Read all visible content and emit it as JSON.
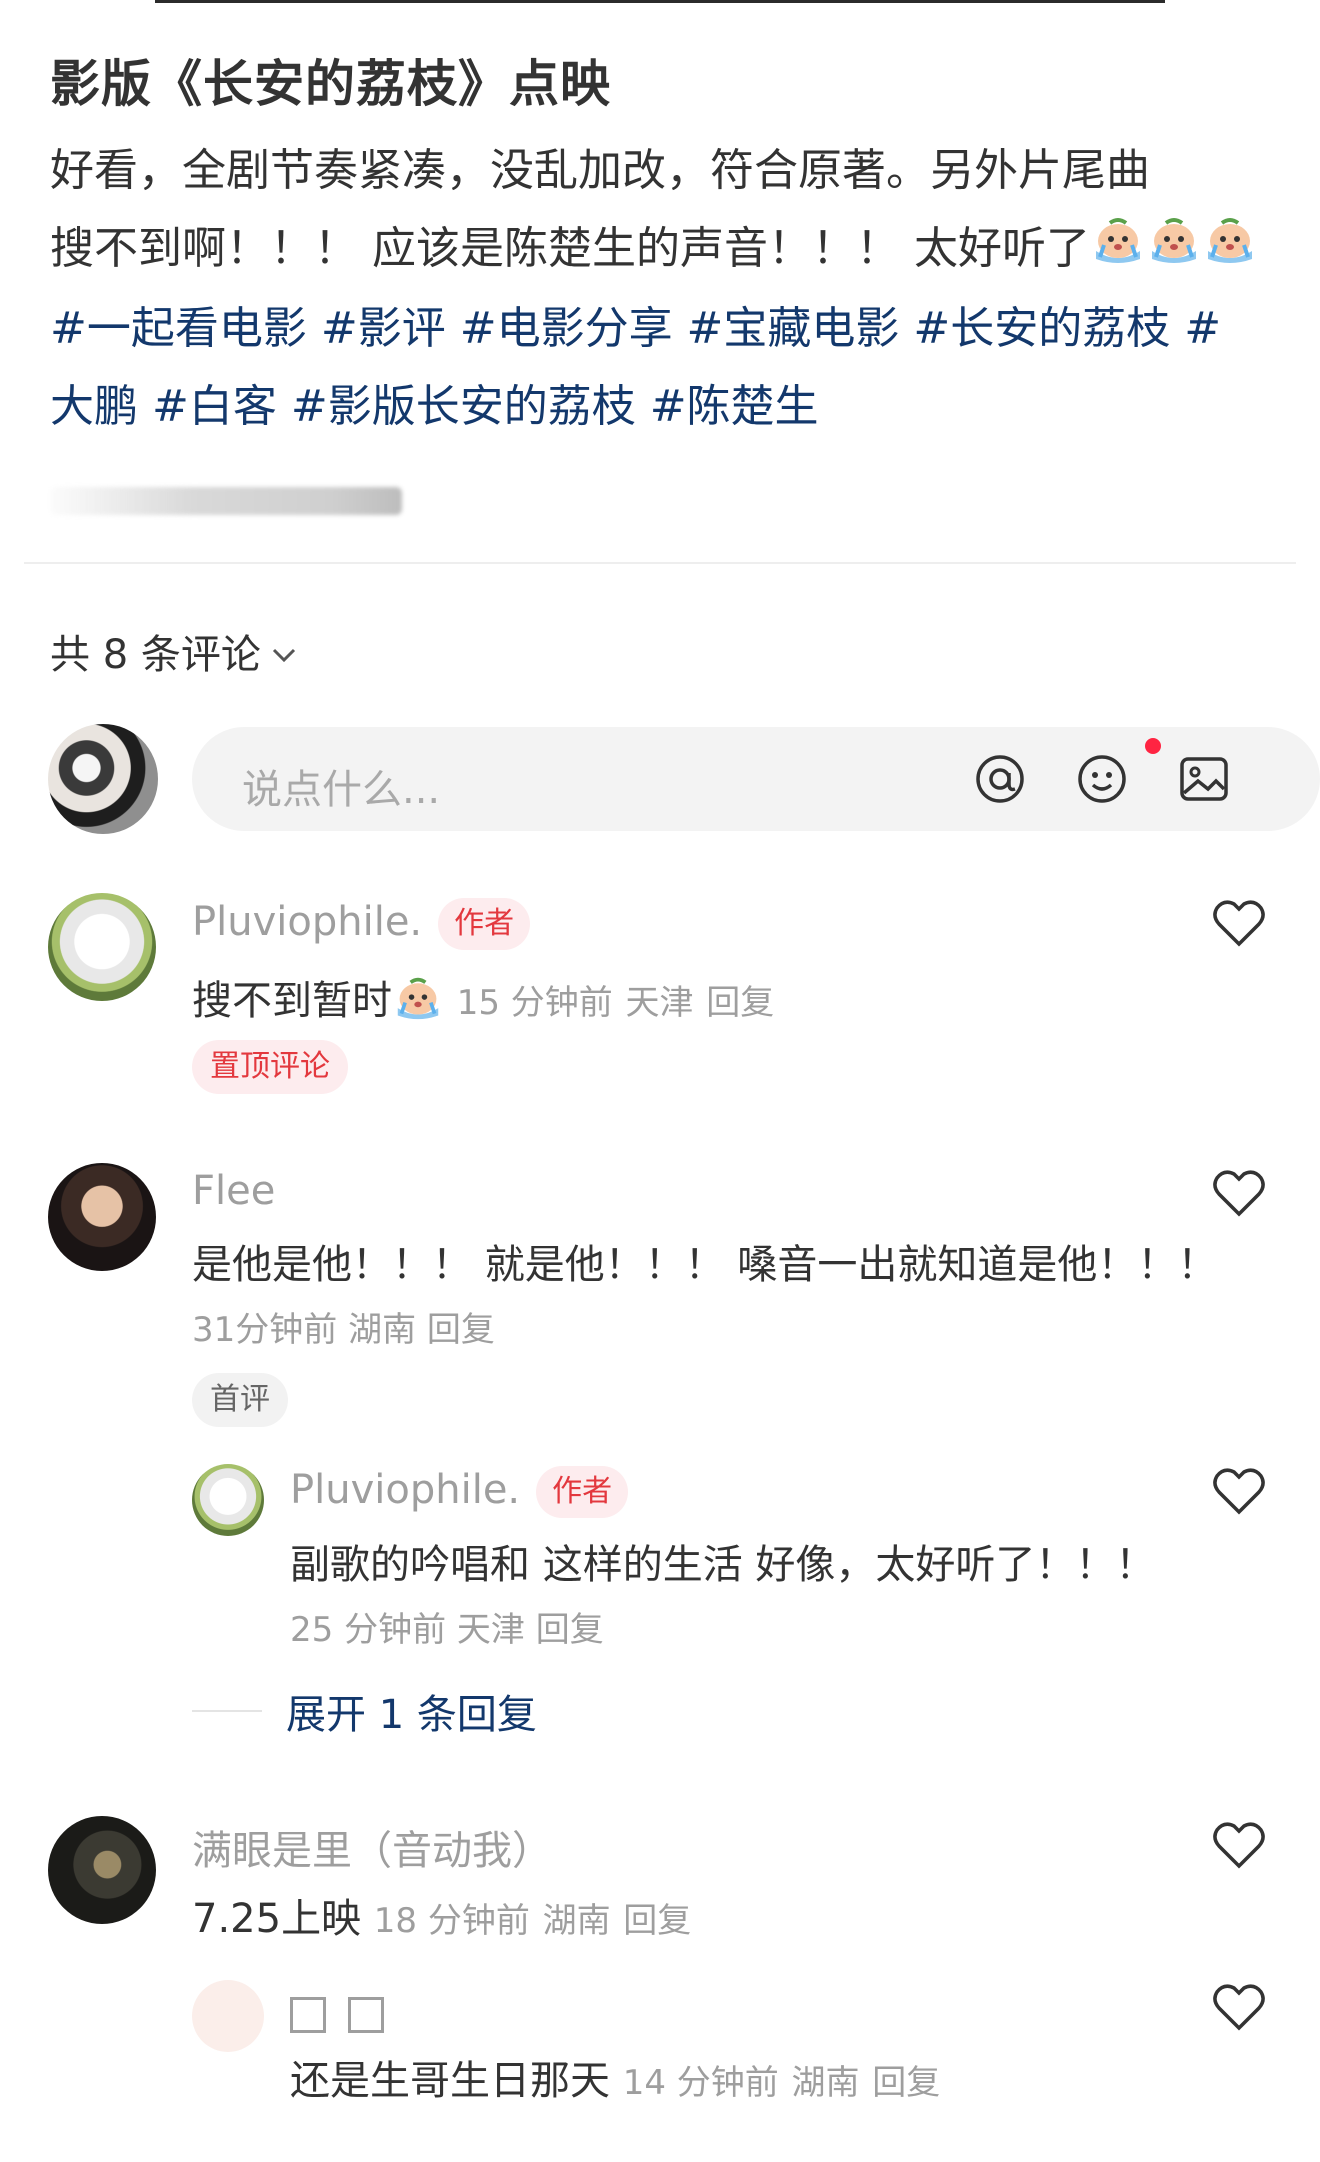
{
  "post": {
    "title": "影版《长安的荔枝》点映",
    "body_line1": "好看，全剧节奏紧凑，没乱加改，符合原著。另外片尾曲",
    "body_line2": "搜不到啊！！！ 应该是陈楚生的声音！！！ 太好听了",
    "tags_line1": "#一起看电影 #影评 #电影分享 #宝藏电影 #长安的荔枝 #",
    "tags_line2": "大鹏 #白客 #影版长安的荔枝 #陈楚生",
    "emoji_name": "crying-face-emoji"
  },
  "comments_header": {
    "label": "共 8 条评论"
  },
  "composer": {
    "placeholder": "说点什么...",
    "at_icon": "at-icon",
    "emoji_icon": "smiley-icon",
    "image_icon": "image-icon",
    "notification_color": "#ff2442"
  },
  "comments": [
    {
      "name": "Pluviophile.",
      "badge": "作者",
      "text": "搜不到暂时",
      "time": "15 分钟前",
      "location": "天津",
      "reply": "回复",
      "pinned_label": "置顶评论"
    },
    {
      "name": "Flee",
      "text": "是他是他！！！ 就是他！！！ 嗓音一出就知道是他！！！",
      "time": "31分钟前",
      "location": "湖南",
      "reply": "回复",
      "first_label": "首评",
      "sub_reply": {
        "name": "Pluviophile.",
        "badge": "作者",
        "text": "副歌的吟唱和 这样的生活 好像，太好听了！！！",
        "time": "25 分钟前",
        "location": "天津",
        "reply": "回复"
      },
      "expand_label": "展开 1 条回复"
    },
    {
      "name": "满眼是里（音动我）",
      "text": "7.25上映",
      "time": "18 分钟前",
      "location": "湖南",
      "reply": "回复",
      "sub_reply": {
        "text": "还是生哥生日那天",
        "time": "14 分钟前",
        "location": "湖南",
        "reply": "回复"
      }
    }
  ],
  "colors": {
    "accent_red": "#e3383e",
    "tag_blue": "#13386c",
    "muted_grey": "#9e9e9e"
  }
}
